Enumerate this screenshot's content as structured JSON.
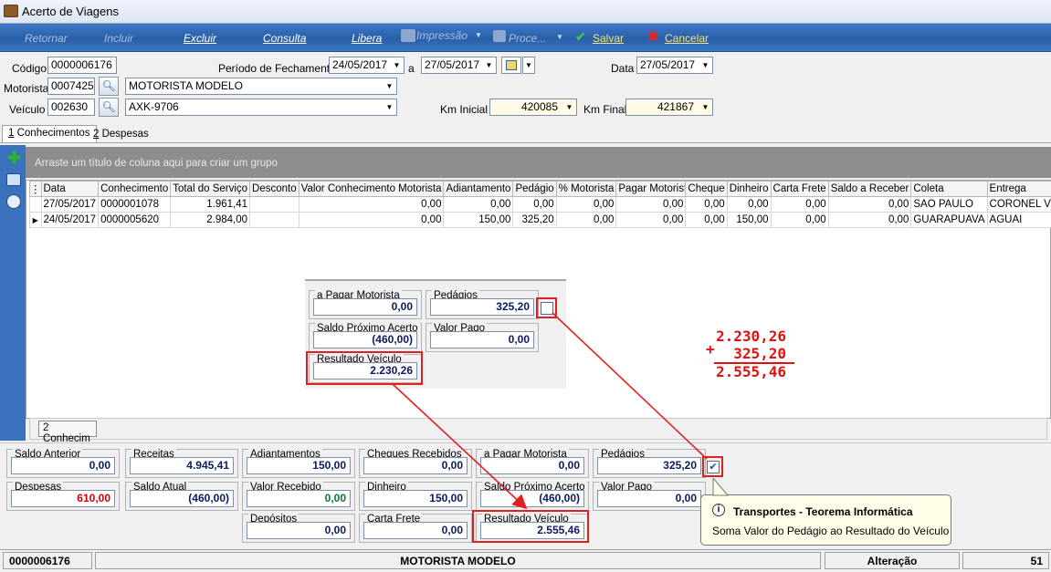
{
  "window": {
    "title": "Acerto de Viagens"
  },
  "toolbar": {
    "retornar": "Retornar",
    "incluir": "Incluir",
    "excluir": "Excluir",
    "consulta": "Consulta",
    "libera": "Libera",
    "impressao": "Impressão",
    "processos": "Proce...",
    "salvar": "Salvar",
    "cancelar": "Cancelar"
  },
  "form": {
    "codigo_label": "Código",
    "codigo": "0000006176",
    "periodo_label": "Período de Fechamento",
    "periodo_inicio": "24/05/2017",
    "periodo_sep": "a",
    "periodo_fim": "27/05/2017",
    "data_label": "Data",
    "data": "27/05/2017",
    "motorista_label": "Motorista",
    "motorista_cod": "0007425",
    "motorista_nome": "MOTORISTA MODELO",
    "veiculo_label": "Veículo",
    "veiculo_cod": "002630",
    "veiculo_placa": "AXK-9706",
    "km_inicial_label": "Km Inicial",
    "km_inicial": "420085",
    "km_final_label": "Km Final",
    "km_final": "421867"
  },
  "tabs": [
    {
      "num": "1",
      "label": " Conhecimentos"
    },
    {
      "num": "2",
      "label": " Despesas"
    }
  ],
  "grid": {
    "group_hint": "Arraste um título de coluna aqui para criar um grupo",
    "columns": [
      "Data",
      "Conhecimento",
      "Total do Serviço",
      "Desconto",
      "Valor Conhecimento Motorista",
      "Adiantamento",
      "Pedágio",
      "% Motorista",
      "Pagar Motorista",
      "Cheque",
      "Dinheiro",
      "Carta Frete",
      "Saldo a Receber",
      "Coleta",
      "Entrega"
    ],
    "rows": [
      [
        "27/05/2017",
        "0000001078",
        "1.961,41",
        "",
        "0,00",
        "0,00",
        "0,00",
        "0,00",
        "0,00",
        "0,00",
        "0,00",
        "0,00",
        "0,00",
        "SAO PAULO",
        "CORONEL VIVIDA"
      ],
      [
        "24/05/2017",
        "0000005620",
        "2.984,00",
        "",
        "0,00",
        "150,00",
        "325,20",
        "0,00",
        "0,00",
        "0,00",
        "150,00",
        "0,00",
        "0,00",
        "GUARAPUAVA",
        "AGUAI"
      ]
    ],
    "footer_count": "2 Conhecim"
  },
  "zoom": {
    "a_pagar_label": "a Pagar Motorista",
    "a_pagar": "0,00",
    "pedagios_label": "Pedágios",
    "pedagios": "325,20",
    "saldo_prox_label": "Saldo Próximo Acerto",
    "saldo_prox": "(460,00)",
    "valor_pago_label": "Valor Pago",
    "valor_pago": "0,00",
    "resultado_label": "Resultado Veículo",
    "resultado": "2.230,26"
  },
  "calc": {
    "a": "2.230,26",
    "plus": "+",
    "b": "325,20",
    "result": "2.555,46"
  },
  "totals": {
    "saldo_anterior_label": "Saldo Anterior",
    "saldo_anterior": "0,00",
    "receitas_label": "Receitas",
    "receitas": "4.945,41",
    "adiantamentos_label": "Adiantamentos",
    "adiantamentos": "150,00",
    "cheques_label": "Cheques Recebidos",
    "cheques": "0,00",
    "a_pagar_label": "a Pagar Motorista",
    "a_pagar": "0,00",
    "pedagios_label": "Pedágios",
    "pedagios": "325,20",
    "despesas_label": "Despesas",
    "despesas": "610,00",
    "saldo_atual_label": "Saldo Atual",
    "saldo_atual": "(460,00)",
    "valor_recebido_label": "Valor Recebido",
    "valor_recebido": "0,00",
    "dinheiro_label": "Dinheiro",
    "dinheiro": "150,00",
    "saldo_prox_label": "Saldo Próximo Acerto",
    "saldo_prox": "(460,00)",
    "valor_pago_label": "Valor Pago",
    "valor_pago": "0,00",
    "depositos_label": "Depósitos",
    "depositos": "0,00",
    "carta_frete_label": "Carta Frete",
    "carta_frete": "0,00",
    "resultado_label": "Resultado Veículo",
    "resultado": "2.555,46"
  },
  "tooltip": {
    "title": "Transportes - Teorema Informática",
    "body": "Soma Valor do Pedágio ao Resultado do Veículo"
  },
  "status": {
    "codigo": "0000006176",
    "motorista": "MOTORISTA MODELO",
    "modo": "Alteração",
    "extra": "51"
  },
  "colors": {
    "accent": "#2a5fa8",
    "highlight": "#e02020",
    "negative": "#d00000",
    "positive": "#0a7a30"
  }
}
